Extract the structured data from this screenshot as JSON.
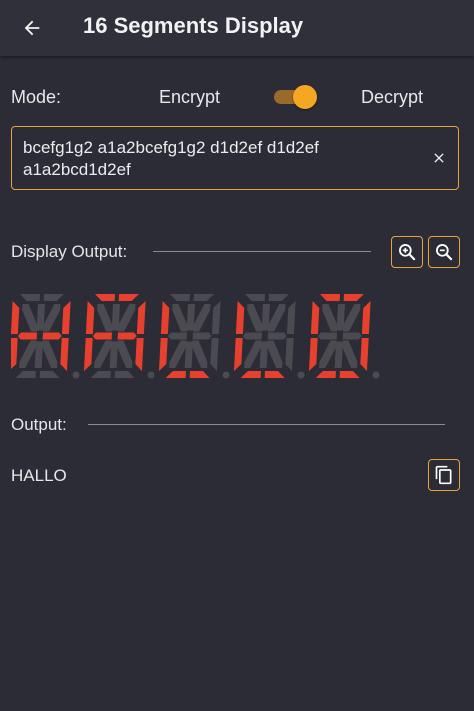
{
  "appbar": {
    "title": "16 Segments Display"
  },
  "mode": {
    "label": "Mode:",
    "encrypt_label": "Encrypt",
    "decrypt_label": "Decrypt",
    "toggle_on": true
  },
  "input": {
    "value": "bcefg1g2 a1a2bcefg1g2 d1d2ef d1d2ef a1a2bcd1d2ef"
  },
  "display_section": {
    "label": "Display Output:"
  },
  "output_section": {
    "label": "Output:",
    "value": "HALLO"
  },
  "display": {
    "characters": [
      [
        "b",
        "c",
        "e",
        "f",
        "g1",
        "g2"
      ],
      [
        "a1",
        "a2",
        "b",
        "c",
        "e",
        "f",
        "g1",
        "g2"
      ],
      [
        "d1",
        "d2",
        "e",
        "f"
      ],
      [
        "d1",
        "d2",
        "e",
        "f"
      ],
      [
        "a1",
        "a2",
        "b",
        "c",
        "d1",
        "d2",
        "e",
        "f"
      ]
    ],
    "on_color": "#e8402e",
    "off_color": "#4a4a50"
  },
  "colors": {
    "accent": "#f5a623",
    "background": "#2b2c36"
  },
  "icons": {
    "back": "arrow-left-icon",
    "clear": "close-icon",
    "zoom_in": "zoom-in-icon",
    "zoom_out": "zoom-out-icon",
    "copy": "copy-icon"
  }
}
